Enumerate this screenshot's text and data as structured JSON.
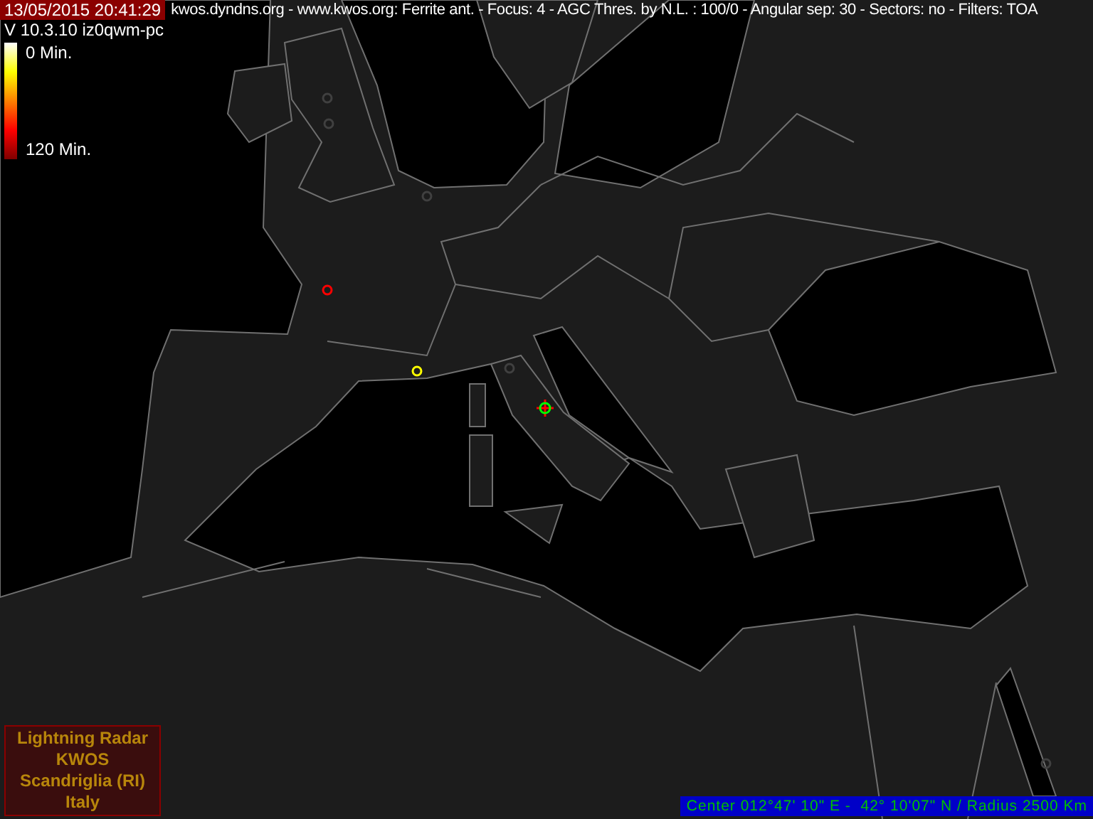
{
  "header": {
    "timestamp": "13/05/2015 20:41:29",
    "info": "kwos.dyndns.org - www.kwos.org: Ferrite ant. - Focus: 4 - AGC Thres. by N.L. : 100/0 - Angular sep: 30 - Sectors: no - Filters: TOA"
  },
  "version": "V 10.3.10 iz0qwm-pc",
  "legend": {
    "top": "0 Min.",
    "bottom": "120 Min."
  },
  "strikes": [
    {
      "color": "#ff0000"
    },
    {
      "color": "#ffff00"
    },
    {
      "color": "#404040"
    },
    {
      "color": "#404040"
    },
    {
      "color": "#404040"
    },
    {
      "color": "#404040"
    },
    {
      "color": "#404040"
    }
  ],
  "station_label": [
    "Lightning Radar",
    "KWOS",
    "Scandriglia (RI)",
    "Italy"
  ],
  "center_info": "Center 012°47' 10\" E -  42° 10'07\" N / Radius 2500 Km"
}
